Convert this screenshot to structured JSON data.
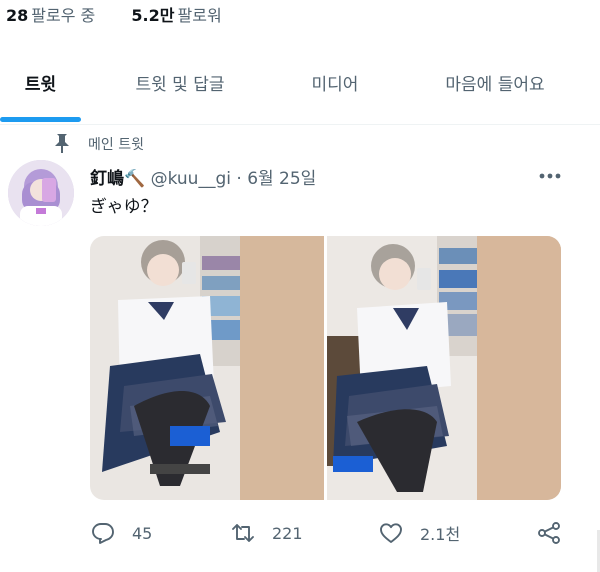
{
  "profile_stats": {
    "following_count": "28",
    "following_label": "팔로우 중",
    "followers_count": "5.2만",
    "followers_label": "팔로워"
  },
  "tabs": [
    {
      "label": "트윗",
      "active": true
    },
    {
      "label": "트윗 및 답글",
      "active": false
    },
    {
      "label": "미디어",
      "active": false
    },
    {
      "label": "마음에 들어요",
      "active": false
    }
  ],
  "pinned_label": "메인 트윗",
  "tweet": {
    "display_name": "釘嶋🔨",
    "handle": "@kuu__gi",
    "separator": "·",
    "date": "6월 25일",
    "text": "ぎゃゆ？",
    "reply_count": "45",
    "retweet_count": "221",
    "like_count": "2.1천"
  },
  "icons": {
    "pin": "pin-icon",
    "more": "more-icon",
    "reply": "reply-icon",
    "retweet": "retweet-icon",
    "like": "heart-icon",
    "share": "share-icon"
  },
  "colors": {
    "accent": "#1d9bf0",
    "secondary_text": "#536471",
    "primary_text": "#0f1419"
  }
}
